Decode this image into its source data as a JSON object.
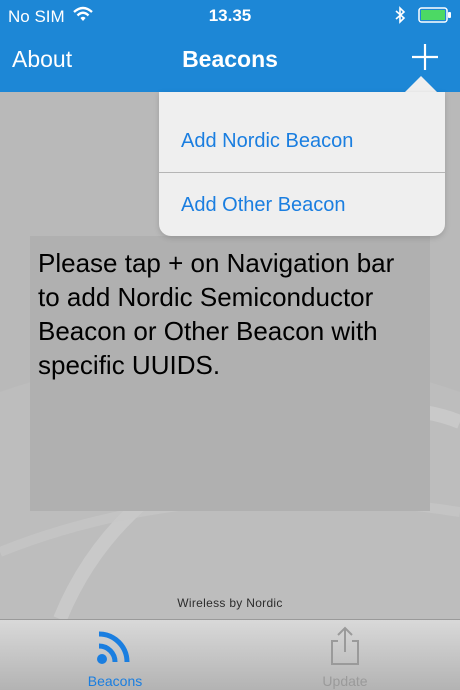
{
  "status_bar": {
    "carrier": "No SIM",
    "time": "13.35"
  },
  "nav": {
    "back_label": "About",
    "title": "Beacons",
    "add_icon": "plus-icon"
  },
  "popover": {
    "items": [
      {
        "label": "Add Nordic Beacon"
      },
      {
        "label": "Add Other Beacon"
      }
    ]
  },
  "main": {
    "message": "Please tap + on Navigation bar to add Nordic Semiconductor Beacon or Other Beacon with specific UUIDS.",
    "footer": "Wireless by Nordic"
  },
  "tabs": [
    {
      "label": "Beacons",
      "icon": "beacon-signal-icon",
      "selected": true
    },
    {
      "label": "Update",
      "icon": "share-upload-icon",
      "selected": false
    }
  ],
  "colors": {
    "accent": "#1d87d6",
    "link": "#1a7ee0"
  }
}
